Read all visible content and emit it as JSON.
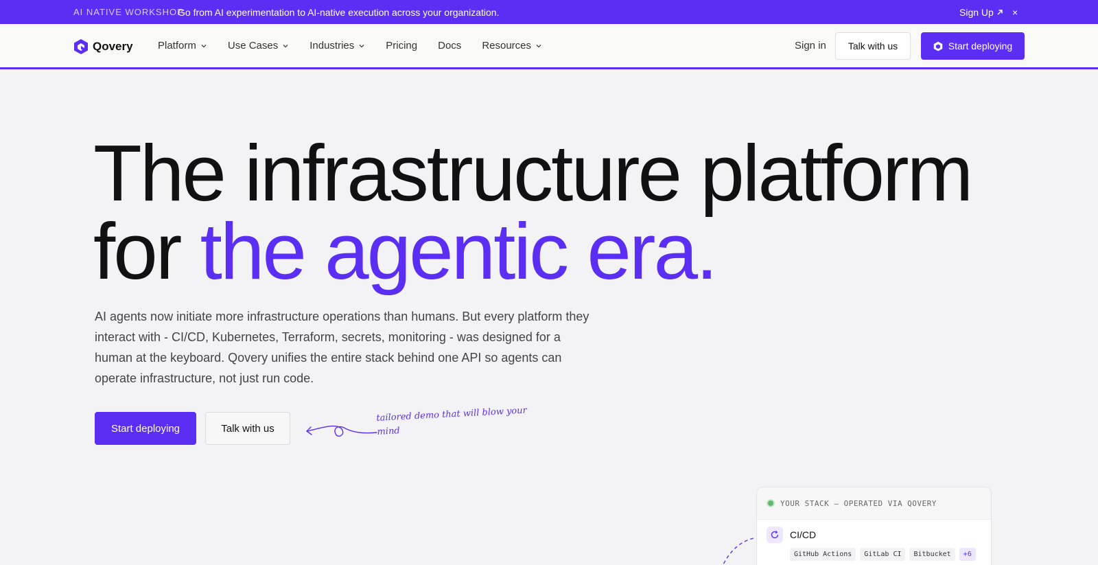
{
  "banner": {
    "tag": "AI NATIVE WORKSHOP",
    "text": "Go from AI experimentation to AI-native execution across your organization.",
    "signup": "Sign Up",
    "close": "×"
  },
  "nav": {
    "logo": "Qovery",
    "items": [
      {
        "label": "Platform",
        "dropdown": true
      },
      {
        "label": "Use Cases",
        "dropdown": true
      },
      {
        "label": "Industries",
        "dropdown": true
      },
      {
        "label": "Pricing",
        "dropdown": false
      },
      {
        "label": "Docs",
        "dropdown": false
      },
      {
        "label": "Resources",
        "dropdown": true
      }
    ],
    "signin": "Sign in",
    "talk": "Talk with us",
    "start": "Start deploying"
  },
  "hero": {
    "line1": "The infrastructure platform",
    "line2_plain": "for ",
    "line2_accent": "the agentic era.",
    "description": "AI agents now initiate more infrastructure operations than humans. But every platform they interact with - CI/CD, Kubernetes, Terraform, secrets, monitoring - was designed for a human at the keyboard. Qovery unifies the entire stack behind one API so agents can operate infrastructure, not just run code.",
    "primary_cta": "Start deploying",
    "secondary_cta": "Talk with us",
    "note": "tailored demo that will blow your mind"
  },
  "stack": {
    "header": "YOUR STACK — OPERATED VIA QOVERY",
    "category": "CI/CD",
    "chips": [
      "GitHub Actions",
      "GitLab CI",
      "Bitbucket"
    ],
    "more": "+6"
  },
  "colors": {
    "accent": "#5b2ff3",
    "status_green": "#5fba6e"
  }
}
